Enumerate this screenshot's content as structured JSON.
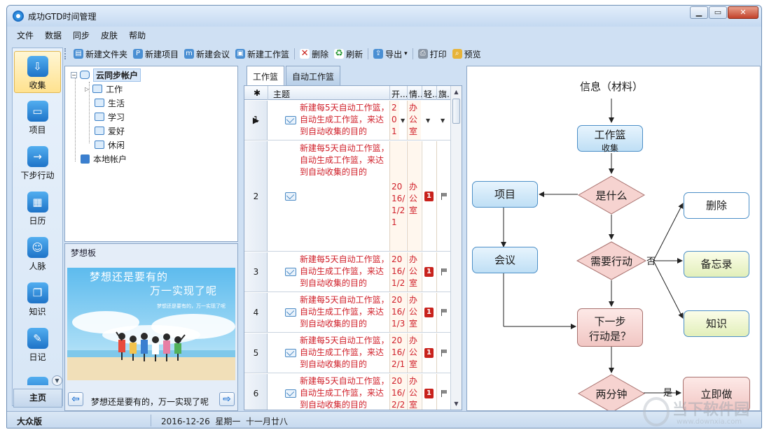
{
  "window": {
    "title": "成功GTD时间管理",
    "controls": [
      "▁",
      "▭",
      "✕"
    ]
  },
  "menu": [
    "文件",
    "数据",
    "同步",
    "皮肤",
    "帮助"
  ],
  "nav": {
    "items": [
      {
        "label": "收集",
        "icon": "inbox-icon",
        "glyph": "⇩",
        "active": true
      },
      {
        "label": "项目",
        "icon": "folder-icon",
        "glyph": "▭"
      },
      {
        "label": "下步行动",
        "icon": "next-action-icon",
        "glyph": "→"
      },
      {
        "label": "日历",
        "icon": "calendar-icon",
        "glyph": "▦"
      },
      {
        "label": "人脉",
        "icon": "contacts-icon",
        "glyph": "☺"
      },
      {
        "label": "知识",
        "icon": "book-icon",
        "glyph": "❐"
      },
      {
        "label": "日记",
        "icon": "diary-icon",
        "glyph": "✎"
      }
    ],
    "home_label": "主页"
  },
  "toolbar": [
    {
      "label": "新建文件夹",
      "icon": "new-folder-icon",
      "glyph": "▤"
    },
    {
      "label": "新建项目",
      "icon": "new-project-icon",
      "glyph": "P"
    },
    {
      "label": "新建会议",
      "icon": "new-meeting-icon",
      "glyph": "m"
    },
    {
      "label": "新建工作篮",
      "icon": "new-basket-icon",
      "glyph": "▣"
    },
    {
      "label": "删除",
      "icon": "delete-icon",
      "glyph": "✕"
    },
    {
      "label": "刷新",
      "icon": "refresh-icon",
      "glyph": "♻"
    },
    {
      "label": "导出",
      "icon": "export-icon",
      "glyph": "⇪",
      "dropdown": "▾"
    },
    {
      "label": "打印",
      "icon": "print-icon",
      "glyph": "⎙"
    },
    {
      "label": "预览",
      "icon": "preview-icon",
      "glyph": "⌕"
    }
  ],
  "tree": {
    "root": "云同步帐户",
    "children": [
      "工作",
      "生活",
      "学习",
      "爱好",
      "休闲"
    ],
    "local": "本地帐户"
  },
  "dream_board": {
    "title": "梦想板",
    "image_text_line1": "梦想还是要有的",
    "image_text_line2": "万一实现了呢",
    "image_small_text": "梦想还是要有的，万一实现了呢",
    "caption": "梦想还是要有的，万一实现了呢"
  },
  "tabs": [
    "工作篮",
    "自动工作篮"
  ],
  "grid": {
    "headers": {
      "star": "✱",
      "subject": "主题",
      "start": "开...",
      "context": "情...",
      "light": "轻...",
      "flag": "旗..."
    },
    "rows": [
      {
        "num": "1",
        "subject": "新建每5天自动工作篮，自动生成工作篮，来达到自动收集的目的",
        "start": "2016/12/16",
        "context": "办公室",
        "priority": "",
        "flag": false,
        "selected": true
      },
      {
        "num": "2",
        "subject": "新建每5天自动工作篮，自动生成工作篮，来达到自动收集的目的",
        "start": "2016/1/21",
        "context": "办公室",
        "priority": "1",
        "flag": true
      },
      {
        "num": "3",
        "subject": "新建每5天自动工作篮，自动生成工作篮，来达到自动收集的目的",
        "start": "2016/1/26",
        "context": "办公室",
        "priority": "1",
        "flag": true
      },
      {
        "num": "4",
        "subject": "新建每5天自动工作篮，自动生成工作篮，来达到自动收集的目的",
        "start": "2016/1/31",
        "context": "办公室",
        "priority": "1",
        "flag": true
      },
      {
        "num": "5",
        "subject": "新建每5天自动工作篮，自动生成工作篮，来达到自动收集的目的",
        "start": "2016/2/10",
        "context": "办公室",
        "priority": "1",
        "flag": true
      },
      {
        "num": "6",
        "subject": "新建每5天自动工作篮，自动生成工作篮，来达到自动收集的目的",
        "start": "2016/2/20",
        "context": "办公室",
        "priority": "1",
        "flag": true
      }
    ]
  },
  "flowchart": {
    "info": "信息（材料）",
    "basket_line1": "工作篮",
    "basket_line2": "收集",
    "what": "是什么",
    "project": "项目",
    "meeting": "会议",
    "need_action": "需要行动",
    "no_label": "否",
    "delete": "删除",
    "memo": "备忘录",
    "knowledge": "知识",
    "next_line1": "下一步",
    "next_line2": "行动是？",
    "two_min": "两分钟",
    "yes_label": "是",
    "do_now": "立即做"
  },
  "status": {
    "edition": "大众版",
    "date": "2016-12-26  星期一  十一月廿八"
  },
  "watermark": {
    "text": "当下软件园",
    "url": "www.downxia.com"
  },
  "colors": {
    "accent": "#1e73c8",
    "subject_red": "#d0202a",
    "priority_red": "#c8221c"
  }
}
